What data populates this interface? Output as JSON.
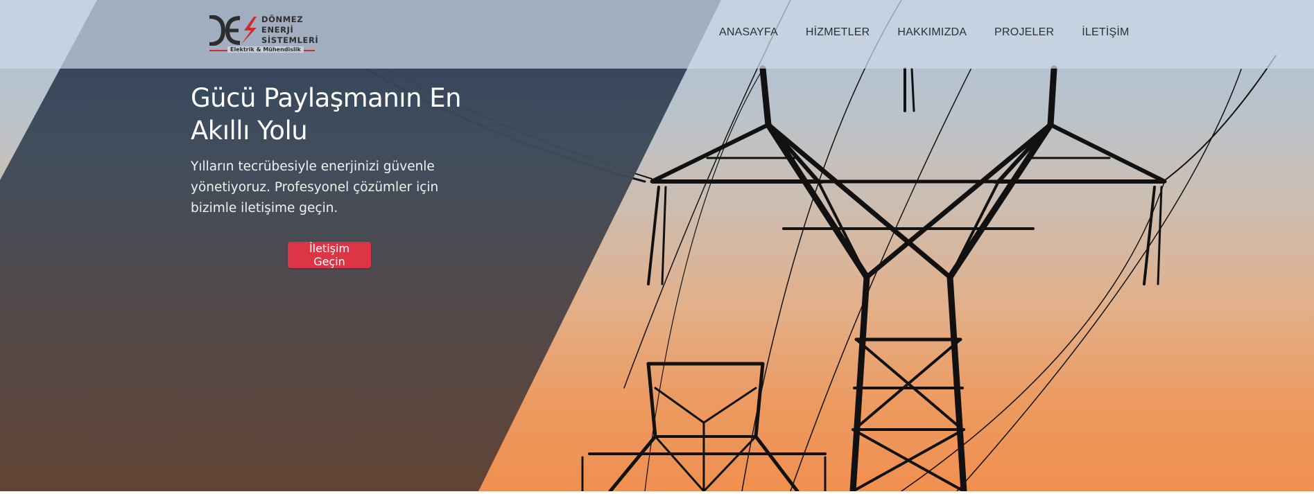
{
  "brand": {
    "name_lines": [
      "DÖNMEZ",
      "ENERJİ",
      "SİSTEMLERİ"
    ],
    "tagline": "Elektrik & Mühendislik",
    "logo_mark": "DES",
    "accent_color": "#d22a2a"
  },
  "nav": {
    "items": [
      {
        "label": "ANASAYFA"
      },
      {
        "label": "HİZMETLER"
      },
      {
        "label": "HAKKIMIZDA"
      },
      {
        "label": "PROJELER"
      },
      {
        "label": "İLETİŞİM"
      }
    ]
  },
  "hero": {
    "title": "Gücü Paylaşmanın En Akıllı Yolu",
    "subtitle": " Yılların tecrübesiyle enerjinizi güvenle yönetiyoruz.  Profesyonel çözümler için bizimle iletişime geçin.",
    "cta_label": "İletişim Geçin",
    "cta_color": "#dc3545",
    "background_image": "power-transmission-towers-sunset"
  }
}
